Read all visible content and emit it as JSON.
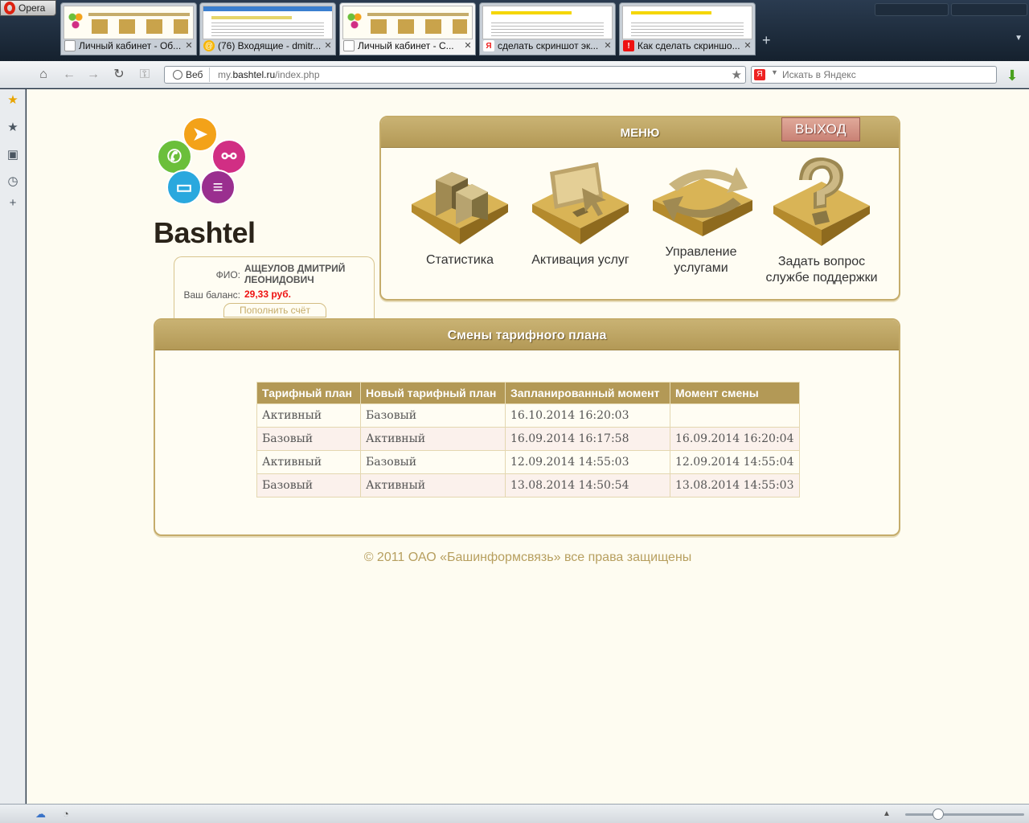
{
  "browser": {
    "app_button": "Opera",
    "tabs": [
      {
        "label": "Личный кабинет - Об...",
        "active": false,
        "fav": "page"
      },
      {
        "label": "(76) Входящие - dmitr...",
        "active": false,
        "fav": "mail"
      },
      {
        "label": "Личный кабинет - С...",
        "active": true,
        "fav": "page"
      },
      {
        "label": "сделать скриншот эк...",
        "active": false,
        "fav": "yandex"
      },
      {
        "label": "Как сделать скриншо...",
        "active": false,
        "fav": "red"
      }
    ],
    "address": {
      "chip": "Веб",
      "url_prefix": "my.",
      "url_domain": "bashtel.ru",
      "url_path": "/index.php"
    },
    "search": {
      "engine_icon": "Я",
      "placeholder": "Искать в Яндекс"
    }
  },
  "page": {
    "logo_text": "Bashtel",
    "user": {
      "fio_label": "ФИО:",
      "fio_value": "АЩЕУЛОВ ДМИТРИЙ ЛЕОНИДОВИЧ",
      "balance_label": "Ваш баланс:",
      "balance_value": "29,33 руб.",
      "topup_label": "Пополнить счёт"
    },
    "menu": {
      "title": "МЕНЮ",
      "logout_label": "ВЫХОД",
      "items": [
        {
          "label": "Статистика"
        },
        {
          "label": "Активация услуг"
        },
        {
          "label": "Управление услугами"
        },
        {
          "label": "Задать вопрос службе поддержки"
        }
      ]
    },
    "tariff": {
      "title": "Смены тарифного плана",
      "headers": [
        "Тарифный план",
        "Новый тарифный план",
        "Запланированный момент",
        "Момент смены"
      ],
      "rows": [
        [
          "Активный",
          "Базовый",
          "16.10.2014 16:20:03",
          ""
        ],
        [
          "Базовый",
          "Активный",
          "16.09.2014 16:17:58",
          "16.09.2014 16:20:04"
        ],
        [
          "Активный",
          "Базовый",
          "12.09.2014 14:55:03",
          "12.09.2014 14:55:04"
        ],
        [
          "Базовый",
          "Активный",
          "13.08.2014 14:50:54",
          "13.08.2014 14:55:03"
        ]
      ]
    },
    "footer": "© 2011 ОАО «Башинформсвязь» все права защищены"
  },
  "colors": {
    "gold": "#b39956",
    "gold_light": "#c9b273",
    "page_bg": "#fefcf1",
    "balance": "#ee1111",
    "logout": "#c98275"
  }
}
